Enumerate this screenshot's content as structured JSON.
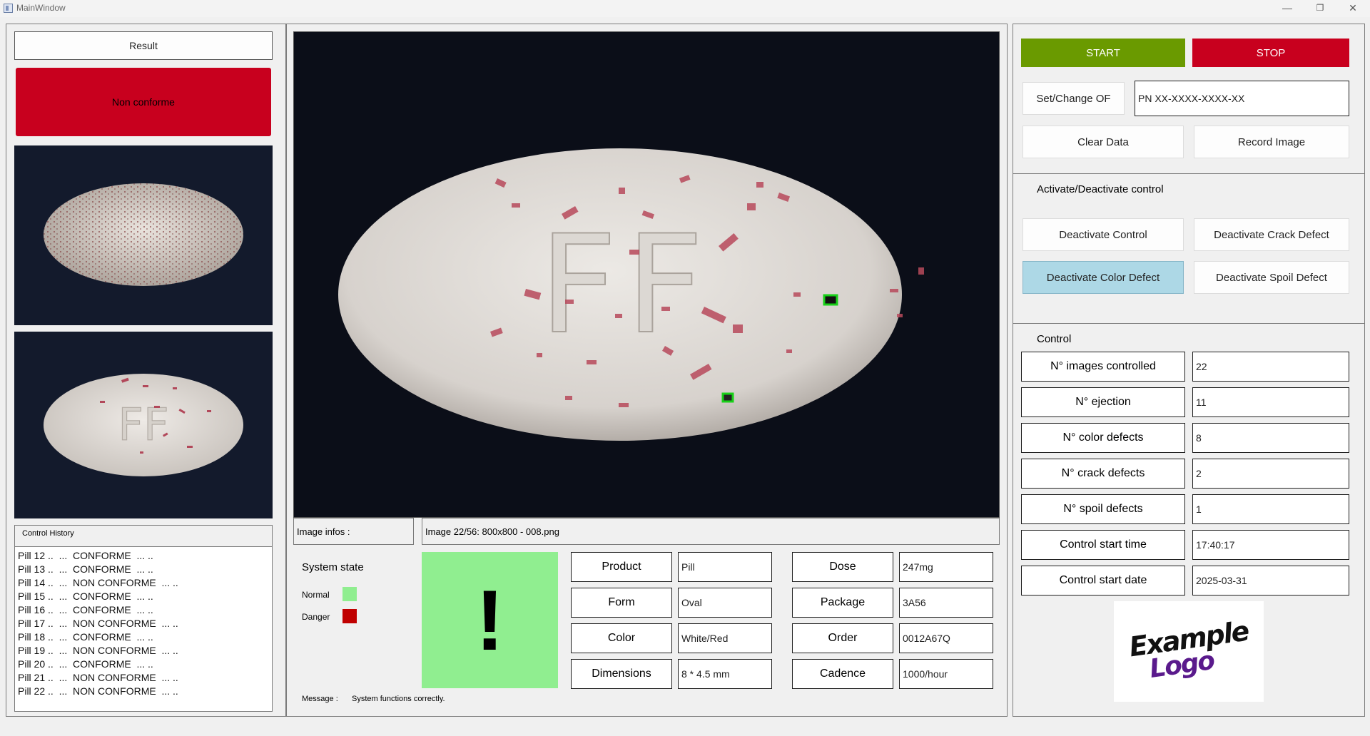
{
  "window": {
    "title": "MainWindow",
    "minimize": "—",
    "restore": "❐",
    "close": "✕"
  },
  "left": {
    "result_label": "Result",
    "result_status": "Non conforme",
    "result_color": "#c8001e",
    "history_title": "Control History",
    "history": [
      "Pill 12 ..  ...  CONFORME  ... ..",
      "Pill 13 ..  ...  CONFORME  ... ..",
      "Pill 14 ..  ...  NON CONFORME  ... ..",
      "Pill 15 ..  ...  CONFORME  ... ..",
      "Pill 16 ..  ...  CONFORME  ... ..",
      "Pill 17 ..  ...  NON CONFORME  ... ..",
      "Pill 18 ..  ...  CONFORME  ... ..",
      "Pill 19 ..  ...  NON CONFORME  ... ..",
      "Pill 20 ..  ...  CONFORME  ... ..",
      "Pill 21 ..  ...  NON CONFORME  ... ..",
      "Pill 22 ..  ...  NON CONFORME  ... .."
    ]
  },
  "center": {
    "main_image_marking": "FF",
    "image_infos_label": "Image infos :",
    "image_infos_value": "Image 22/56: 800x800 - 008.png",
    "system_state_label": "System state",
    "normal_label": "Normal",
    "danger_label": "Danger",
    "normal_color": "#90ee90",
    "danger_color": "#c00000",
    "indicator_symbol": "!",
    "indicator_color": "#90ee90",
    "message_label": "Message :",
    "message_value": "System functions correctly.",
    "product_info": [
      {
        "label": "Product",
        "value": "Pill"
      },
      {
        "label": "Form",
        "value": "Oval"
      },
      {
        "label": "Color",
        "value": "White/Red"
      },
      {
        "label": "Dimensions",
        "value": "8 * 4.5 mm"
      }
    ],
    "order_info": [
      {
        "label": "Dose",
        "value": "247mg"
      },
      {
        "label": "Package",
        "value": "3A56"
      },
      {
        "label": "Order",
        "value": "0012A67Q"
      },
      {
        "label": "Cadence",
        "value": "1000/hour"
      }
    ]
  },
  "right": {
    "start_label": "START",
    "start_color": "#6a9a00",
    "stop_label": "STOP",
    "stop_color": "#c8001e",
    "set_of_label": "Set/Change OF",
    "of_value": "PN XX-XXXX-XXXX-XX",
    "clear_label": "Clear Data",
    "record_label": "Record Image",
    "activate_section_label": "Activate/Deactivate control",
    "deactivate_control": "Deactivate Control",
    "deactivate_crack": "Deactivate Crack Defect",
    "deactivate_color": "Deactivate Color Defect",
    "deactivate_spoil": "Deactivate Spoil Defect",
    "active_button_color": "#add8e6",
    "control_section_label": "Control",
    "stats": [
      {
        "label": "N° images controlled",
        "value": "22"
      },
      {
        "label": "N° ejection",
        "value": "11"
      },
      {
        "label": "N° color defects",
        "value": "8"
      },
      {
        "label": "N° crack defects",
        "value": "2"
      },
      {
        "label": "N° spoil defects",
        "value": "1"
      },
      {
        "label": "Control start time",
        "value": "17:40:17"
      },
      {
        "label": "Control start date",
        "value": "2025-03-31"
      }
    ],
    "logo_line1": "Example",
    "logo_line2": "Logo"
  }
}
